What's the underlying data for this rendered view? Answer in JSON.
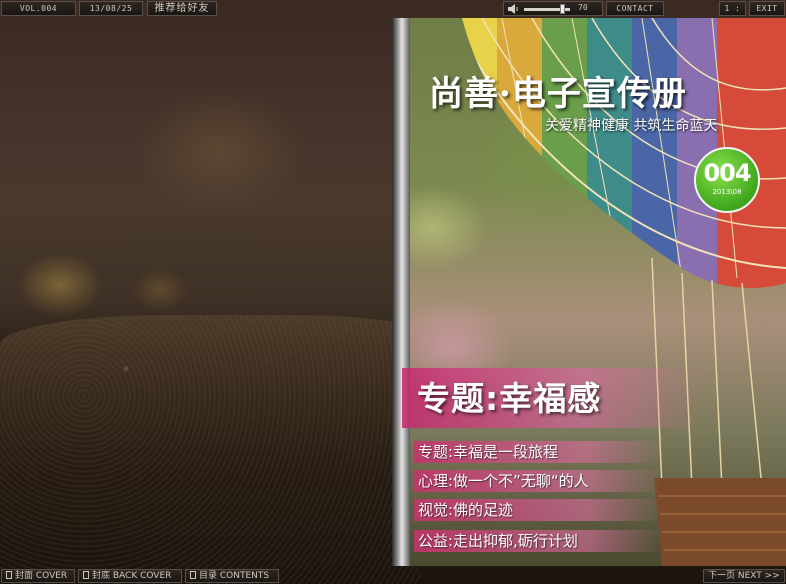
{
  "toolbar": {
    "vol": "VOL.004",
    "date": "13/08/25",
    "share": "推荐给好友",
    "volume_value": "70",
    "contact": "CONTACT",
    "ratio": "1 : 1",
    "exit": "EXIT"
  },
  "magazine": {
    "title": "尚善·电子宣传册",
    "subtitle": "关爱精神健康 共筑生命蓝天",
    "issue_number": "004",
    "issue_date": "2013\\08",
    "feature_title": "专题:幸福感",
    "toc": [
      "专题:幸福是一段旅程",
      "心理:做一个不”无聊“的人",
      "视觉:佛的足迹",
      "公益:走出抑郁,砺行计划"
    ]
  },
  "bottom_nav": {
    "cover": "封面 COVER",
    "back_cover": "封底 BACK COVER",
    "contents": "目录 CONTENTS",
    "next": "下一页 NEXT >>"
  },
  "colors": {
    "badge_green": "#3ea61c",
    "feature_pink": "#c8286e",
    "toolbar_bg": "#1a1613"
  }
}
